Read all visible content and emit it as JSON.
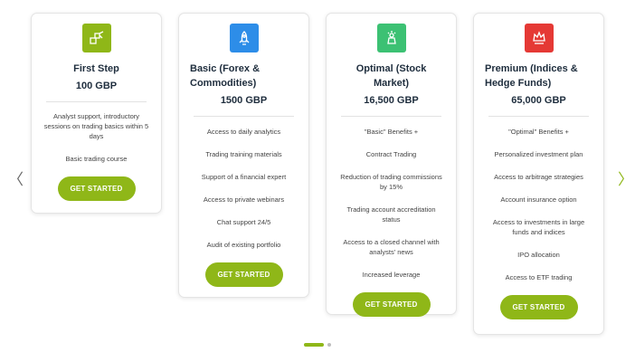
{
  "colors": {
    "accent": "#8fb718",
    "icon_first": "#8fb718",
    "icon_basic": "#2d8de8",
    "icon_optimal": "#3cc173",
    "icon_premium": "#e53935"
  },
  "navigation": {
    "prev_icon": "chevron-left-icon",
    "next_icon": "chevron-right-icon",
    "prev_label": "〈",
    "next_label": "〉",
    "active_slide": 1,
    "slide_count": 2
  },
  "plans": [
    {
      "icon": "steps-icon",
      "title": "First Step",
      "price": "100 GBP",
      "features": [
        "Analyst support, introductory sessions on trading basics within 5 days",
        "Basic trading course"
      ],
      "button": "GET STARTED"
    },
    {
      "icon": "rocket-icon",
      "title": "Basic (Forex & Commodities)",
      "price": "1500 GBP",
      "features": [
        "Access to daily analytics",
        "Trading training materials",
        "Support of a financial expert",
        "Access to private webinars",
        "Chat support 24/5",
        "Audit of existing portfolio"
      ],
      "button": "GET STARTED"
    },
    {
      "icon": "medal-icon",
      "title": "Optimal (Stock Market)",
      "price": "16,500 GBP",
      "features": [
        "\"Basic\" Benefits +",
        "Contract Trading",
        "Reduction of trading commissions by 15%",
        "Trading account accreditation status",
        "Access to a closed channel with analysts' news",
        "Increased leverage"
      ],
      "button": "GET STARTED"
    },
    {
      "icon": "crown-icon",
      "title": "Premium (Indices & Hedge Funds)",
      "price": "65,000 GBP",
      "features": [
        "\"Optimal\" Benefits +",
        "Personalized investment plan",
        "Access to arbitrage strategies",
        "Account insurance option",
        "Access to investments in large funds and indices",
        "IPO allocation",
        "Access to ETF trading"
      ],
      "button": "GET STARTED"
    }
  ]
}
